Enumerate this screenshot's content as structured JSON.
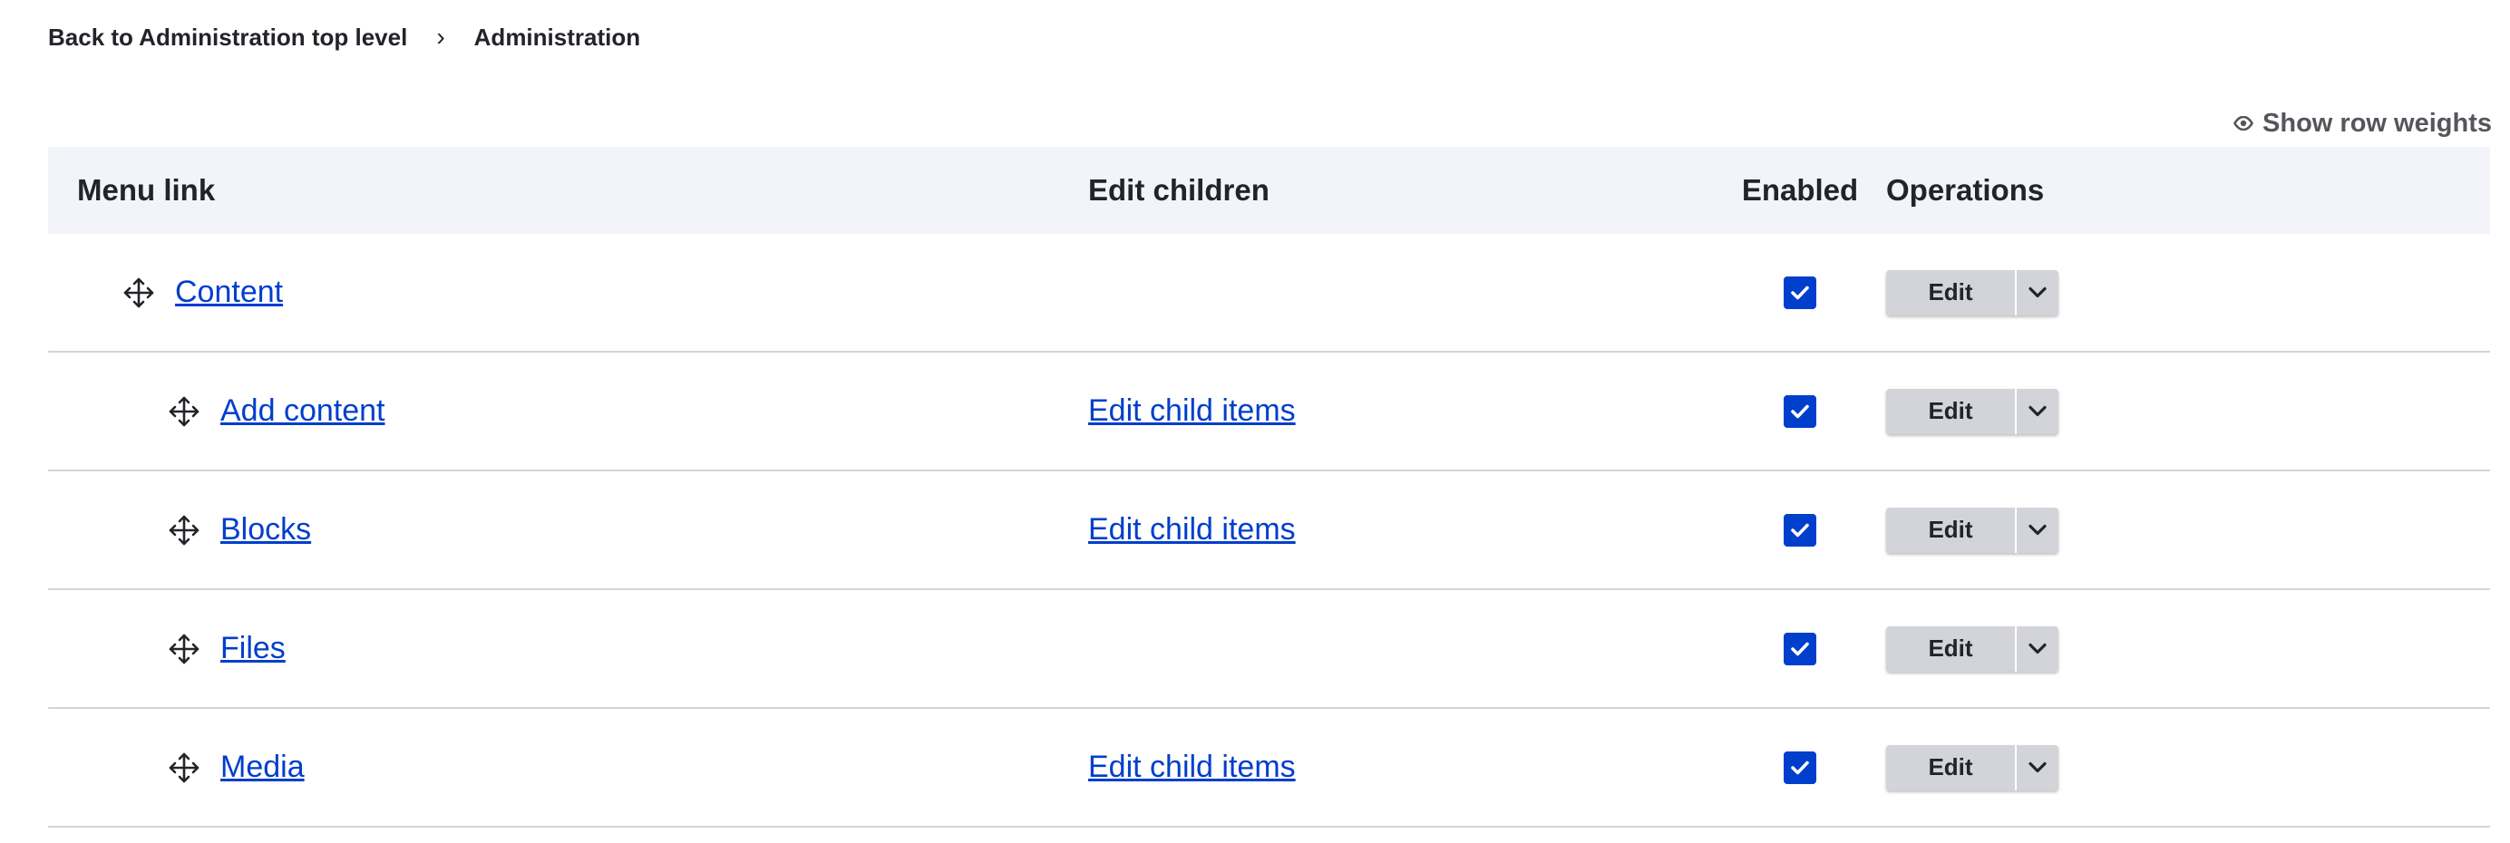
{
  "breadcrumb": {
    "back_label": "Back to Administration top level",
    "separator": "›",
    "current_label": "Administration"
  },
  "toolbar": {
    "show_weights_label": "Show row weights"
  },
  "table": {
    "headers": {
      "menu_link": "Menu link",
      "edit_children": "Edit children",
      "enabled": "Enabled",
      "operations": "Operations"
    },
    "rows": [
      {
        "label": "Content",
        "level": 1,
        "child_link": "",
        "enabled": true,
        "edit_label": "Edit"
      },
      {
        "label": "Add content",
        "level": 2,
        "child_link": "Edit child items",
        "enabled": true,
        "edit_label": "Edit"
      },
      {
        "label": "Blocks",
        "level": 2,
        "child_link": "Edit child items",
        "enabled": true,
        "edit_label": "Edit"
      },
      {
        "label": "Files",
        "level": 2,
        "child_link": "",
        "enabled": true,
        "edit_label": "Edit"
      },
      {
        "label": "Media",
        "level": 2,
        "child_link": "Edit child items",
        "enabled": true,
        "edit_label": "Edit"
      }
    ]
  },
  "colors": {
    "link": "#003ecc",
    "checkbox": "#003ecc",
    "header_bg": "#f3f4f9",
    "row_border": "#d3d4d9",
    "button_bg": "#d3d4d9",
    "text": "#232429"
  },
  "icons": {
    "drag": "move-icon",
    "eye": "eye-icon",
    "check": "check-icon",
    "chevron": "chevron-down-icon"
  }
}
